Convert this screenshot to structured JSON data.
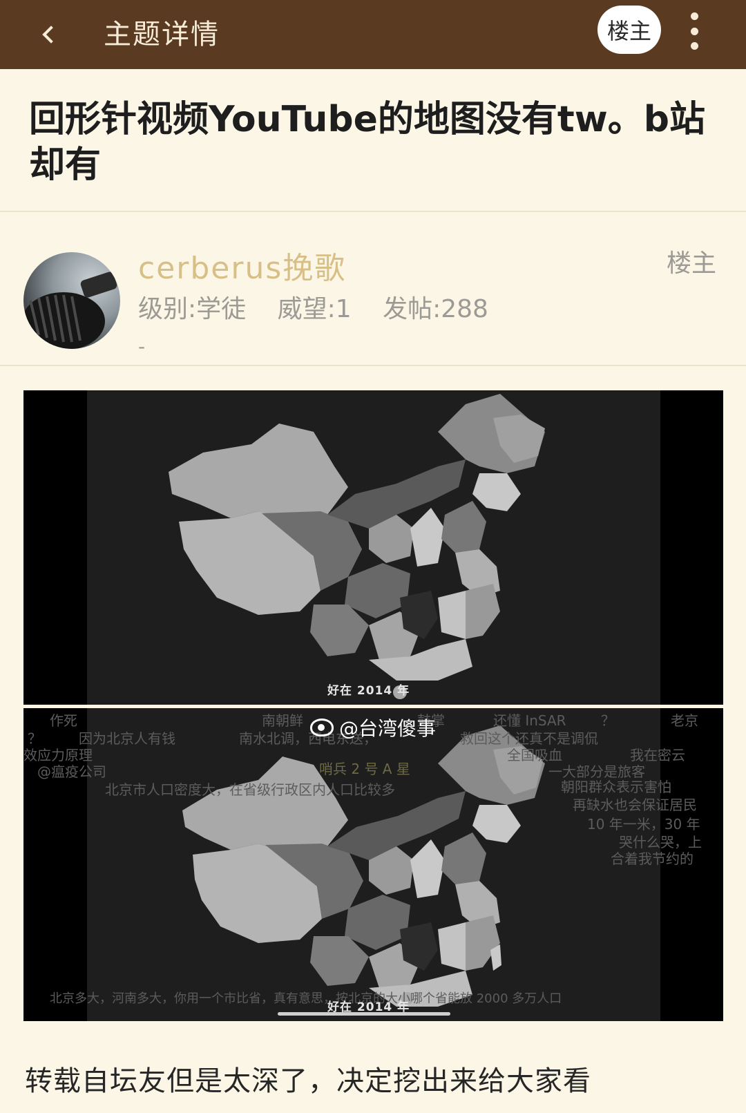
{
  "header": {
    "title": "主题详情",
    "op_button": "楼主"
  },
  "thread": {
    "title": "回形针视频YouTube的地图没有tw。b站却有"
  },
  "author": {
    "name": "cerberus挽歌",
    "level": "级别:学徒",
    "prestige": "威望:1",
    "posts": "发帖:288",
    "extra": "-",
    "op_tag": "楼主"
  },
  "image1": {
    "caption": "好在 2014 年"
  },
  "image2": {
    "caption": "好在 2014 年",
    "watermark": "@台湾傻事",
    "danmaku": [
      "作死",
      "南朝鲜",
      "鼓掌",
      "还懂 InSAR",
      "？",
      "老京",
      "？",
      "因为北京人有钱",
      "南水北调，西电东送，",
      "救回这个还真不是调侃",
      "效应力原理",
      "全国吸血",
      "我在密云",
      "@瘟疫公司",
      "哨兵 2 号 A 星",
      "一大部分是旅客",
      "北京市人口密度大，在省级行政区内人口比较多",
      "朝阳群众表示害怕",
      "再缺水也会保证居民",
      "10 年一米，30 年",
      "哭什么哭，上",
      "合着我节约的",
      "北京多大，河南多大，你用一个市比省，真有意思，按北京的大小哪个省能放 2000 多万人口"
    ]
  },
  "post": {
    "text": "转载自坛友但是太深了，决定挖出来给大家看"
  }
}
